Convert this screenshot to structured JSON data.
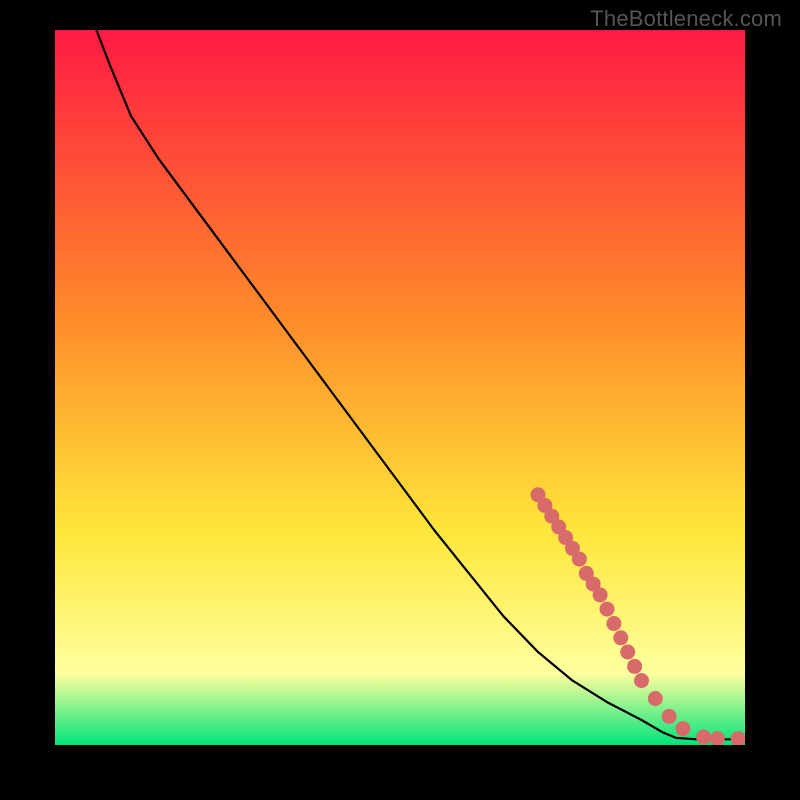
{
  "watermark_text": "TheBottleneck.com",
  "colors": {
    "top": "#ff1a44",
    "mid1": "#ff8a2a",
    "mid2": "#ffe63a",
    "pale": "#ffff9e",
    "green": "#00e47a",
    "curve": "#000000",
    "point": "#d86a6a",
    "bg": "#000000"
  },
  "chart_data": {
    "type": "line",
    "title": "",
    "xlabel": "",
    "ylabel": "",
    "xlim": [
      0,
      100
    ],
    "ylim": [
      0,
      100
    ],
    "curve": {
      "comment": "Black curve. x,y in 0..100. Starts near top-left, slight shoulder ~x=10, then near-linear descent to ~x=90 where it flattens at baseline ~y=0.8.",
      "points": [
        [
          6,
          100
        ],
        [
          8,
          95
        ],
        [
          11,
          88
        ],
        [
          15,
          82
        ],
        [
          20,
          75.5
        ],
        [
          25,
          69
        ],
        [
          30,
          62.5
        ],
        [
          35,
          56
        ],
        [
          40,
          49.5
        ],
        [
          45,
          43
        ],
        [
          50,
          36.5
        ],
        [
          55,
          30
        ],
        [
          60,
          24
        ],
        [
          65,
          18
        ],
        [
          70,
          13
        ],
        [
          75,
          9
        ],
        [
          80,
          6
        ],
        [
          85,
          3.5
        ],
        [
          88,
          1.8
        ],
        [
          90,
          1.0
        ],
        [
          93,
          0.8
        ],
        [
          96,
          0.8
        ],
        [
          100,
          0.8
        ]
      ]
    },
    "series": [
      {
        "name": "markers",
        "comment": "Salmon circular markers. Dense cluster on the steep segment ~x 70-84, then sparse along the flat bottom.",
        "x": [
          70,
          71,
          72,
          73,
          74,
          75,
          76,
          77,
          78,
          79,
          80,
          81,
          82,
          83,
          84,
          85,
          87,
          89,
          91,
          94,
          96,
          99
        ],
        "y": [
          35,
          33.5,
          32,
          30.5,
          29,
          27.5,
          26,
          24,
          22.5,
          21,
          19,
          17,
          15,
          13,
          11,
          9,
          6.5,
          4,
          2.3,
          1.1,
          0.9,
          0.9
        ]
      }
    ]
  }
}
